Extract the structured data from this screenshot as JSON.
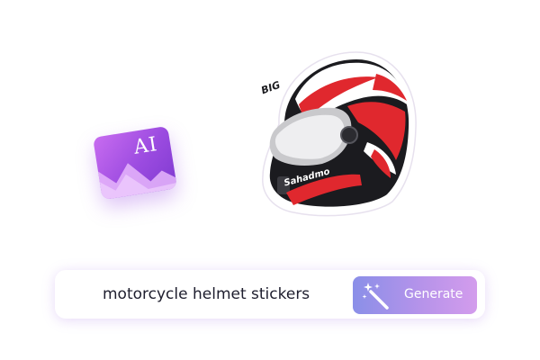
{
  "ai_badge": {
    "text": "AI",
    "icon": "ai-image-icon"
  },
  "helmet_sticker": {
    "icon": "motorcycle-helmet-icon",
    "top_logo": "BIG",
    "side_logo": "Sahadmo"
  },
  "prompt": {
    "value": "motorcycle helmet stickers",
    "button_label": "Generate",
    "button_icon": "magic-wand-icon"
  },
  "colors": {
    "accent_purple": "#9b4be0",
    "button_start": "#8a8fe8",
    "button_end": "#d39cec",
    "helmet_red": "#e0282e"
  }
}
